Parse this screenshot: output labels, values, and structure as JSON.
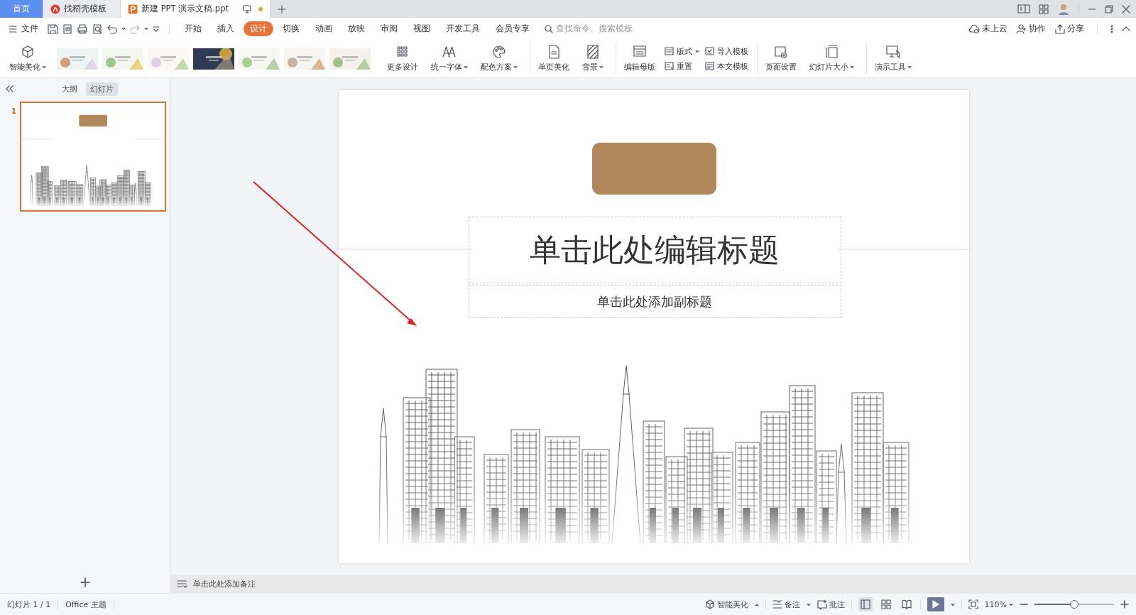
{
  "tab_bar": {
    "tabs": [
      {
        "label": "首页",
        "kind": "home",
        "selected": false
      },
      {
        "label": "找稻壳模板",
        "kind": "template",
        "selected": false
      },
      {
        "label": "新建 PPT 演示文稿.ppt",
        "kind": "document",
        "selected": true,
        "unsaved": true
      }
    ]
  },
  "menu_bar": {
    "file": "文件",
    "tabs": [
      {
        "label": "开始",
        "selected": false
      },
      {
        "label": "插入",
        "selected": false
      },
      {
        "label": "设计",
        "selected": true
      },
      {
        "label": "切换",
        "selected": false
      },
      {
        "label": "动画",
        "selected": false
      },
      {
        "label": "放映",
        "selected": false
      },
      {
        "label": "审阅",
        "selected": false
      },
      {
        "label": "视图",
        "selected": false
      },
      {
        "label": "开发工具",
        "selected": false
      },
      {
        "label": "会员专享",
        "selected": false
      }
    ],
    "search": {
      "placeholder": "查找命令、搜索模板"
    },
    "actions": [
      "未上云",
      "协作",
      "分享"
    ]
  },
  "ribbon": {
    "smart_beautify": {
      "label": "智能美化",
      "dropdown": true
    },
    "templates": [
      {
        "kind": "picture"
      },
      {
        "kind": "picture"
      },
      {
        "kind": "picture"
      },
      {
        "kind": "picture"
      },
      {
        "kind": "picture"
      },
      {
        "kind": "picture"
      },
      {
        "kind": "picture"
      }
    ],
    "groups": [
      [
        {
          "kind": "large",
          "label": "更多设计",
          "dropdown": false
        },
        {
          "kind": "large",
          "label": "统一字体",
          "dropdown": true
        },
        {
          "kind": "large",
          "label": "配色方案",
          "dropdown": true
        }
      ],
      [
        {
          "kind": "large",
          "label": "单页美化",
          "dropdown": false
        },
        {
          "kind": "large",
          "label": "背景",
          "dropdown": true
        }
      ],
      [
        {
          "kind": "large",
          "label": "编辑母版",
          "dropdown": false
        },
        {
          "kind": "stack",
          "items": [
            {
              "label": "版式",
              "dropdown": true
            },
            {
              "label": "重置",
              "dropdown": false
            }
          ]
        },
        {
          "kind": "stack",
          "items": [
            {
              "label": "导入模板",
              "dropdown": false
            },
            {
              "label": "本文模板",
              "dropdown": false
            }
          ]
        }
      ],
      [
        {
          "kind": "large",
          "label": "页面设置",
          "dropdown": false
        },
        {
          "kind": "large",
          "label": "幻灯片大小",
          "dropdown": true
        }
      ],
      [
        {
          "kind": "large",
          "label": "演示工具",
          "dropdown": true
        }
      ]
    ]
  },
  "sidebar": {
    "tabs": [
      {
        "label": "大纲",
        "selected": false
      },
      {
        "label": "幻灯片",
        "selected": true
      }
    ],
    "slides": [
      {
        "number": "1",
        "selected": true
      }
    ]
  },
  "editor": {
    "slide": {
      "title": "单击此处编辑标题",
      "subtitle": "单击此处添加副标题"
    },
    "notes": {
      "placeholder": "单击此处添加备注"
    }
  },
  "status_bar": {
    "slide_counter": "幻灯片 1 / 1",
    "theme": "Office 主题",
    "smart_beautify": "智能美化",
    "notes": "备注",
    "comments": "批注",
    "views": [
      {
        "selected": true
      },
      {
        "selected": false
      },
      {
        "selected": false
      }
    ],
    "zoom": {
      "reading": "110%",
      "level": 0.5
    }
  }
}
